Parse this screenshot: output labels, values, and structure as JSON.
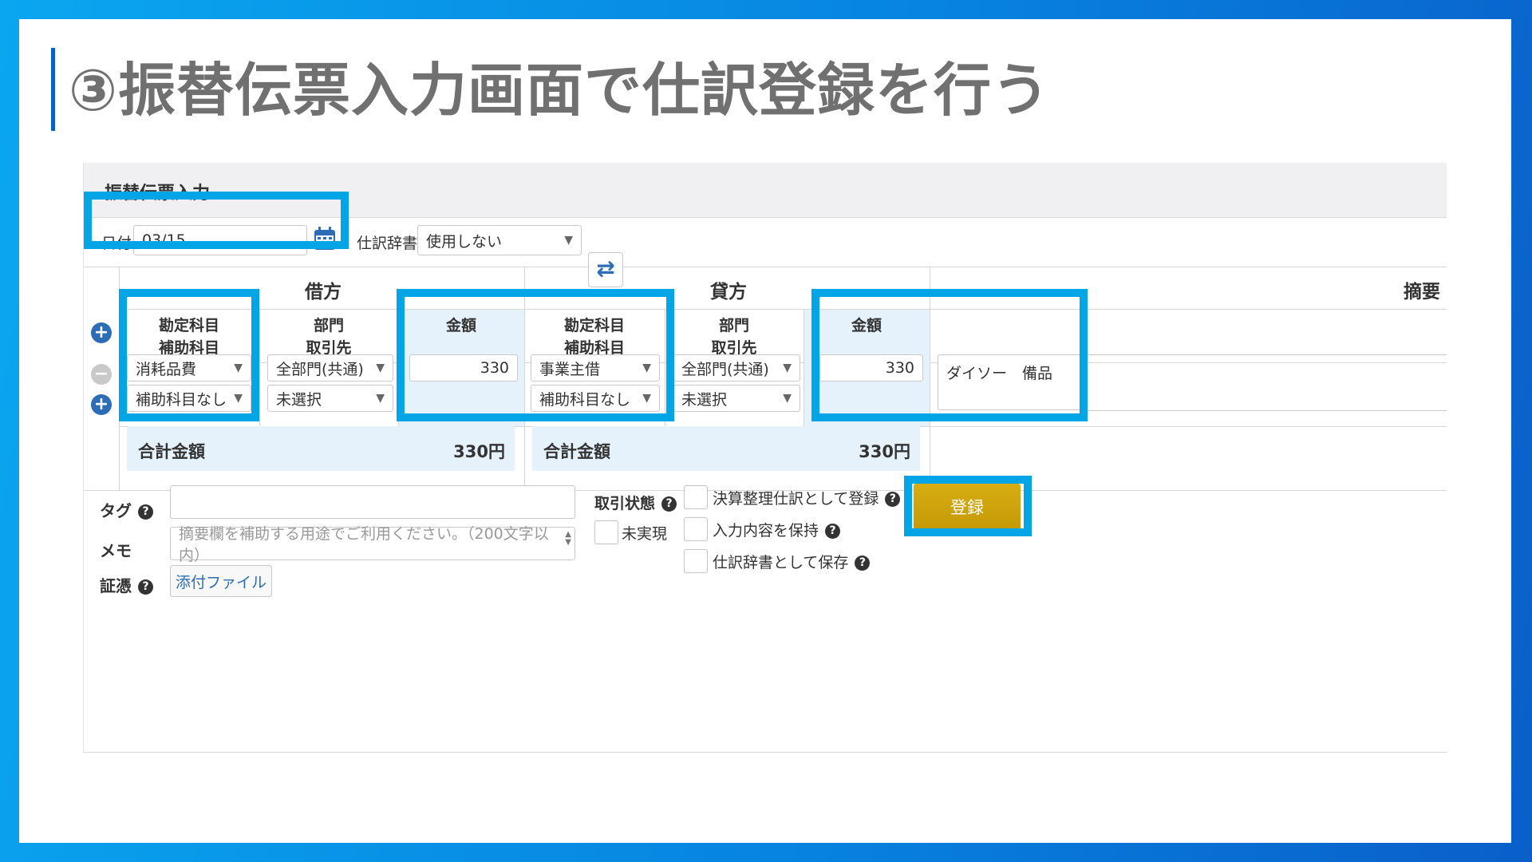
{
  "slide": {
    "title": "③振替伝票入力画面で仕訳登録を行う"
  },
  "panel": {
    "title": "振替伝票入力",
    "date": {
      "label": "日付",
      "value": "03/15"
    },
    "dictionary": {
      "label": "仕訳辞書",
      "value": "使用しない"
    },
    "debit": {
      "heading": "借方",
      "account_head_1": "勘定科目",
      "account_head_2": "補助科目",
      "dept_head_1": "部門",
      "dept_head_2": "取引先",
      "amount_head": "金額",
      "account": "消耗品費",
      "sub_account": "補助科目なし",
      "department": "全部門(共通)",
      "partner": "未選択",
      "amount": "330",
      "total_label": "合計金額",
      "total_value": "330円"
    },
    "credit": {
      "heading": "貸方",
      "account_head_1": "勘定科目",
      "account_head_2": "補助科目",
      "dept_head_1": "部門",
      "dept_head_2": "取引先",
      "amount_head": "金額",
      "account": "事業主借",
      "sub_account": "補助科目なし",
      "department": "全部門(共通)",
      "partner": "未選択",
      "amount": "330",
      "total_label": "合計金額",
      "total_value": "330円"
    },
    "summary": {
      "heading": "摘要",
      "value": "ダイソー　備品"
    },
    "tag": {
      "label": "タグ",
      "value": ""
    },
    "memo": {
      "label": "メモ",
      "placeholder": "摘要欄を補助する用途でご利用ください。（200文字以内）"
    },
    "evidence": {
      "label": "証憑",
      "button": "添付ファイル"
    },
    "status": {
      "label": "取引状態",
      "option": "未実現"
    },
    "options": {
      "closing": "決算整理仕訳として登録",
      "keep": "入力内容を保持",
      "save_dict": "仕訳辞書として保存"
    },
    "register_button": "登録"
  },
  "icons": {
    "calendar": "calendar-icon",
    "swap": "swap-arrows-icon",
    "add": "plus-circle-icon",
    "remove": "minus-circle-icon",
    "help": "question-circle-icon",
    "caret": "caret-down-icon"
  },
  "colors": {
    "highlight": "#04a5e7",
    "amount_bg": "#e5f2fc",
    "register": "#c99e08",
    "title": "#707070"
  }
}
